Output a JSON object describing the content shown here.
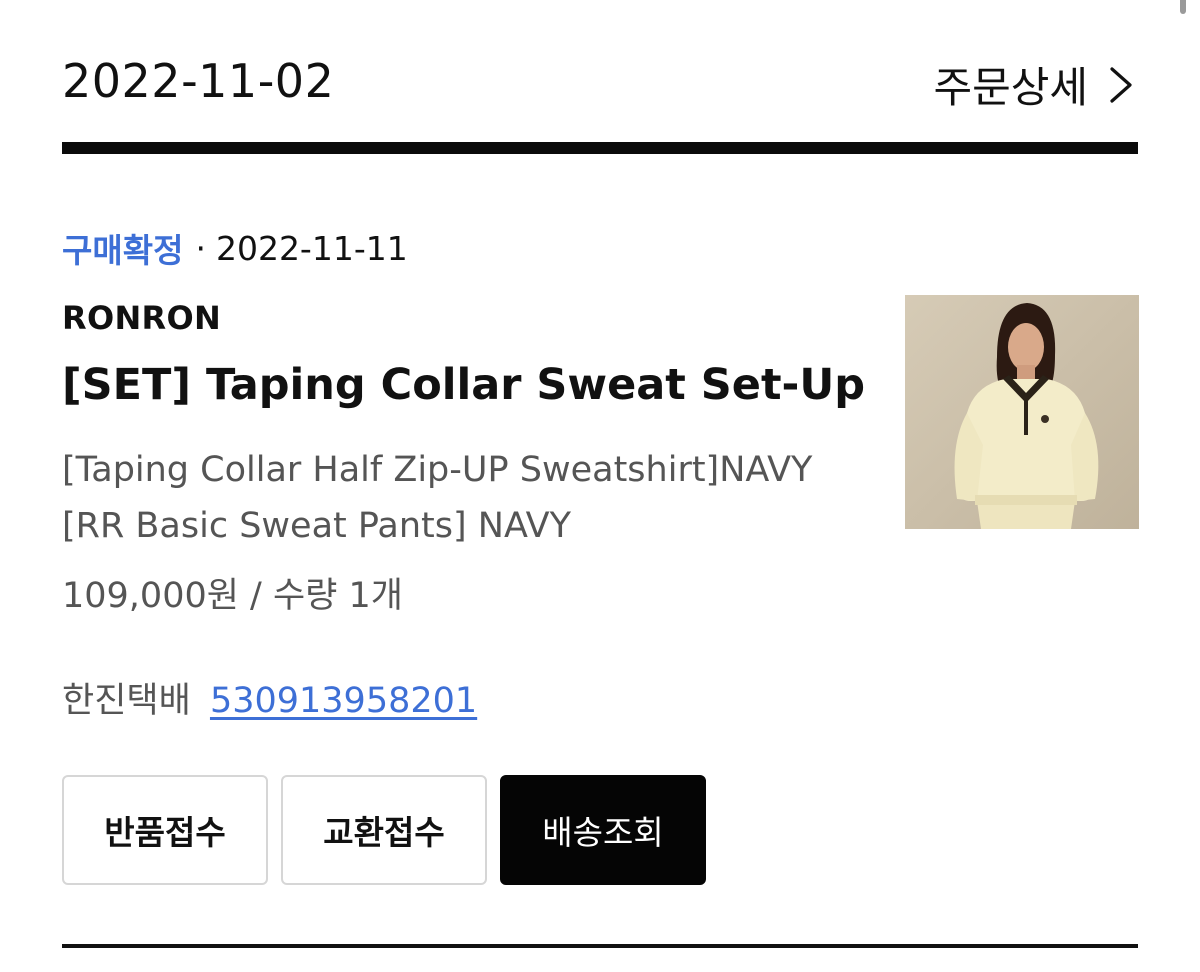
{
  "order": {
    "date": "2022-11-02",
    "detail_link_label": "주문상세"
  },
  "item": {
    "status": "구매확정",
    "separator": "·",
    "status_date": "2022-11-11",
    "brand": "RONRON",
    "name": "[SET] Taping Collar Sweat Set-Up",
    "option": "[Taping Collar Half Zip-UP Sweatshirt]NAVY [RR Basic Sweat Pants] NAVY",
    "price_qty": "109,000원 / 수량 1개"
  },
  "shipping": {
    "carrier": "한진택배",
    "tracking_number": "530913958201"
  },
  "actions": {
    "return_label": "반품접수",
    "exchange_label": "교환접수",
    "track_label": "배송조회"
  },
  "colors": {
    "accent_blue": "#3d6fd6",
    "primary_button": "#050505",
    "muted_text": "#555555"
  }
}
